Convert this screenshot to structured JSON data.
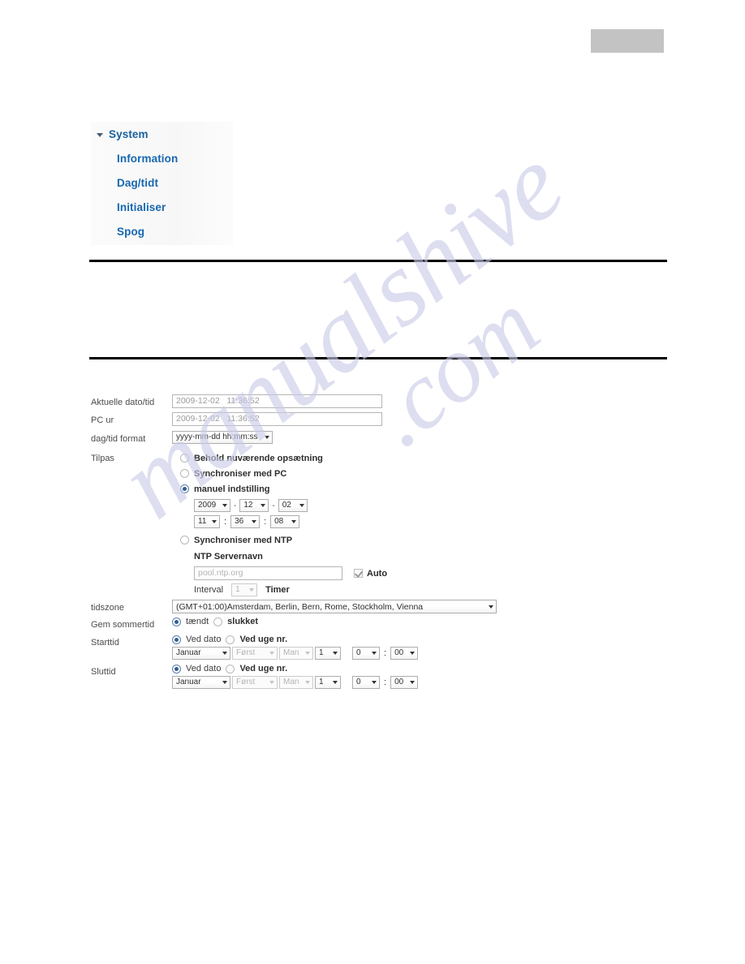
{
  "watermark": {
    "line1": "manualshive",
    "line2": ".com"
  },
  "header": {
    "gray_block": ""
  },
  "nav": {
    "caret_icon": "triangle-down-icon",
    "items": [
      {
        "label": "System",
        "level": 0
      },
      {
        "label": "Information",
        "level": 1
      },
      {
        "label": "Dag/tidt",
        "level": 1
      },
      {
        "label": "Initialiser",
        "level": 1
      },
      {
        "label": "Spog",
        "level": 1
      }
    ]
  },
  "form": {
    "current_datetime": {
      "label": "Aktuelle dato/tid",
      "value": "2009-12-02   11:36:52"
    },
    "pc_clock": {
      "label": "PC ur",
      "value": "2009-12-02   11:36:52"
    },
    "datetime_format": {
      "label": "dag/tid format",
      "value": "yyyy-mm-dd hh:mm:ss"
    },
    "adjust": {
      "label": "Tilpas",
      "options": [
        {
          "label": "Behold nuværende opsætning",
          "selected": false
        },
        {
          "label": "Synchroniser med PC",
          "selected": false
        },
        {
          "label": "manuel indstilling",
          "selected": true
        },
        {
          "label": "Synchroniser med NTP",
          "selected": false
        }
      ],
      "manual": {
        "year": "2009",
        "month": "12",
        "day": "02",
        "hour": "11",
        "minute": "36",
        "second": "08",
        "date_sep": "-",
        "time_sep": ":"
      },
      "ntp": {
        "server_title": "NTP Servernavn",
        "server_placeholder": "pool.ntp.org",
        "auto_label": "Auto",
        "auto_checked": true,
        "interval_label": "Interval",
        "interval_value": "1",
        "interval_unit": "Timer"
      }
    },
    "timezone": {
      "label": "tidszone",
      "value": "(GMT+01:00)Amsterdam, Berlin, Bern, Rome, Stockholm, Vienna"
    },
    "dst": {
      "label": "Gem sommertid",
      "options": [
        {
          "label": "tændt",
          "selected": true
        },
        {
          "label": "slukket",
          "selected": false
        }
      ]
    },
    "start_time": {
      "label": "Starttid",
      "mode_options": [
        {
          "label": "Ved dato",
          "selected": true
        },
        {
          "label": "Ved uge nr.",
          "selected": false
        }
      ],
      "month": "Januar",
      "week": "Først",
      "weekday": "Man",
      "day": "1",
      "hour": "0",
      "minute": "00",
      "time_sep": ":"
    },
    "end_time": {
      "label": "Sluttid",
      "mode_options": [
        {
          "label": "Ved dato",
          "selected": true
        },
        {
          "label": "Ved uge nr.",
          "selected": false
        }
      ],
      "month": "Januar",
      "week": "Først",
      "weekday": "Man",
      "day": "1",
      "hour": "0",
      "minute": "00",
      "time_sep": ":"
    }
  },
  "colors": {
    "nav_link": "#1767b0",
    "rule": "#000000",
    "gray_block": "#c3c3c3",
    "watermark": "#c9cbe8"
  }
}
